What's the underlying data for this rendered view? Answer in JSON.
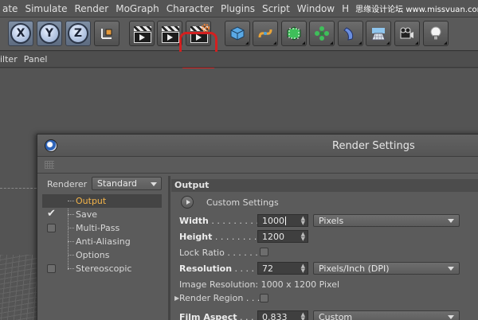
{
  "menubar": {
    "items": [
      "ate",
      "Simulate",
      "Render",
      "MoGraph",
      "Character",
      "Plugins",
      "Script",
      "Window",
      "H"
    ],
    "watermark": "思缘设计论坛 www.missvuan.com"
  },
  "toolbar": {
    "axis_x": "X",
    "axis_y": "Y",
    "axis_z": "Z"
  },
  "submenu": {
    "items": [
      "ilter",
      "Panel"
    ]
  },
  "dialog": {
    "title": "Render Settings",
    "renderer_label": "Renderer",
    "renderer_value": "Standard",
    "list": [
      {
        "label": "Output",
        "checked": null
      },
      {
        "label": "Save",
        "checked": true
      },
      {
        "label": "Multi-Pass",
        "checked": false
      },
      {
        "label": "Anti-Aliasing",
        "checked": null
      },
      {
        "label": "Options",
        "checked": null
      },
      {
        "label": "Stereoscopic",
        "checked": false
      }
    ],
    "section_title": "Output",
    "custom_settings": "Custom Settings",
    "width_label": "Width",
    "width_dots": " . . . . . . . . . .",
    "width_value": "1000",
    "width_unit": "Pixels",
    "height_label": "Height",
    "height_dots": " . . . . . . . . . .",
    "height_value": "1200",
    "lock_ratio_label": "Lock Ratio",
    "lock_ratio_dots": " . . . . . . .",
    "resolution_label": "Resolution",
    "resolution_dots": " . . . . . .",
    "resolution_value": "72",
    "resolution_unit": "Pixels/Inch (DPI)",
    "image_resolution": "Image Resolution: 1000 x 1200 Pixel",
    "render_region_label": "Render Region",
    "render_region_dots": " . . .",
    "film_aspect_label": "Film Aspect",
    "film_aspect_dots": " . . . . . .",
    "film_aspect_value": "0.833",
    "film_aspect_preset": "Custom"
  },
  "colors": {
    "highlight": "#d32020",
    "active_item": "#f3b44a"
  }
}
